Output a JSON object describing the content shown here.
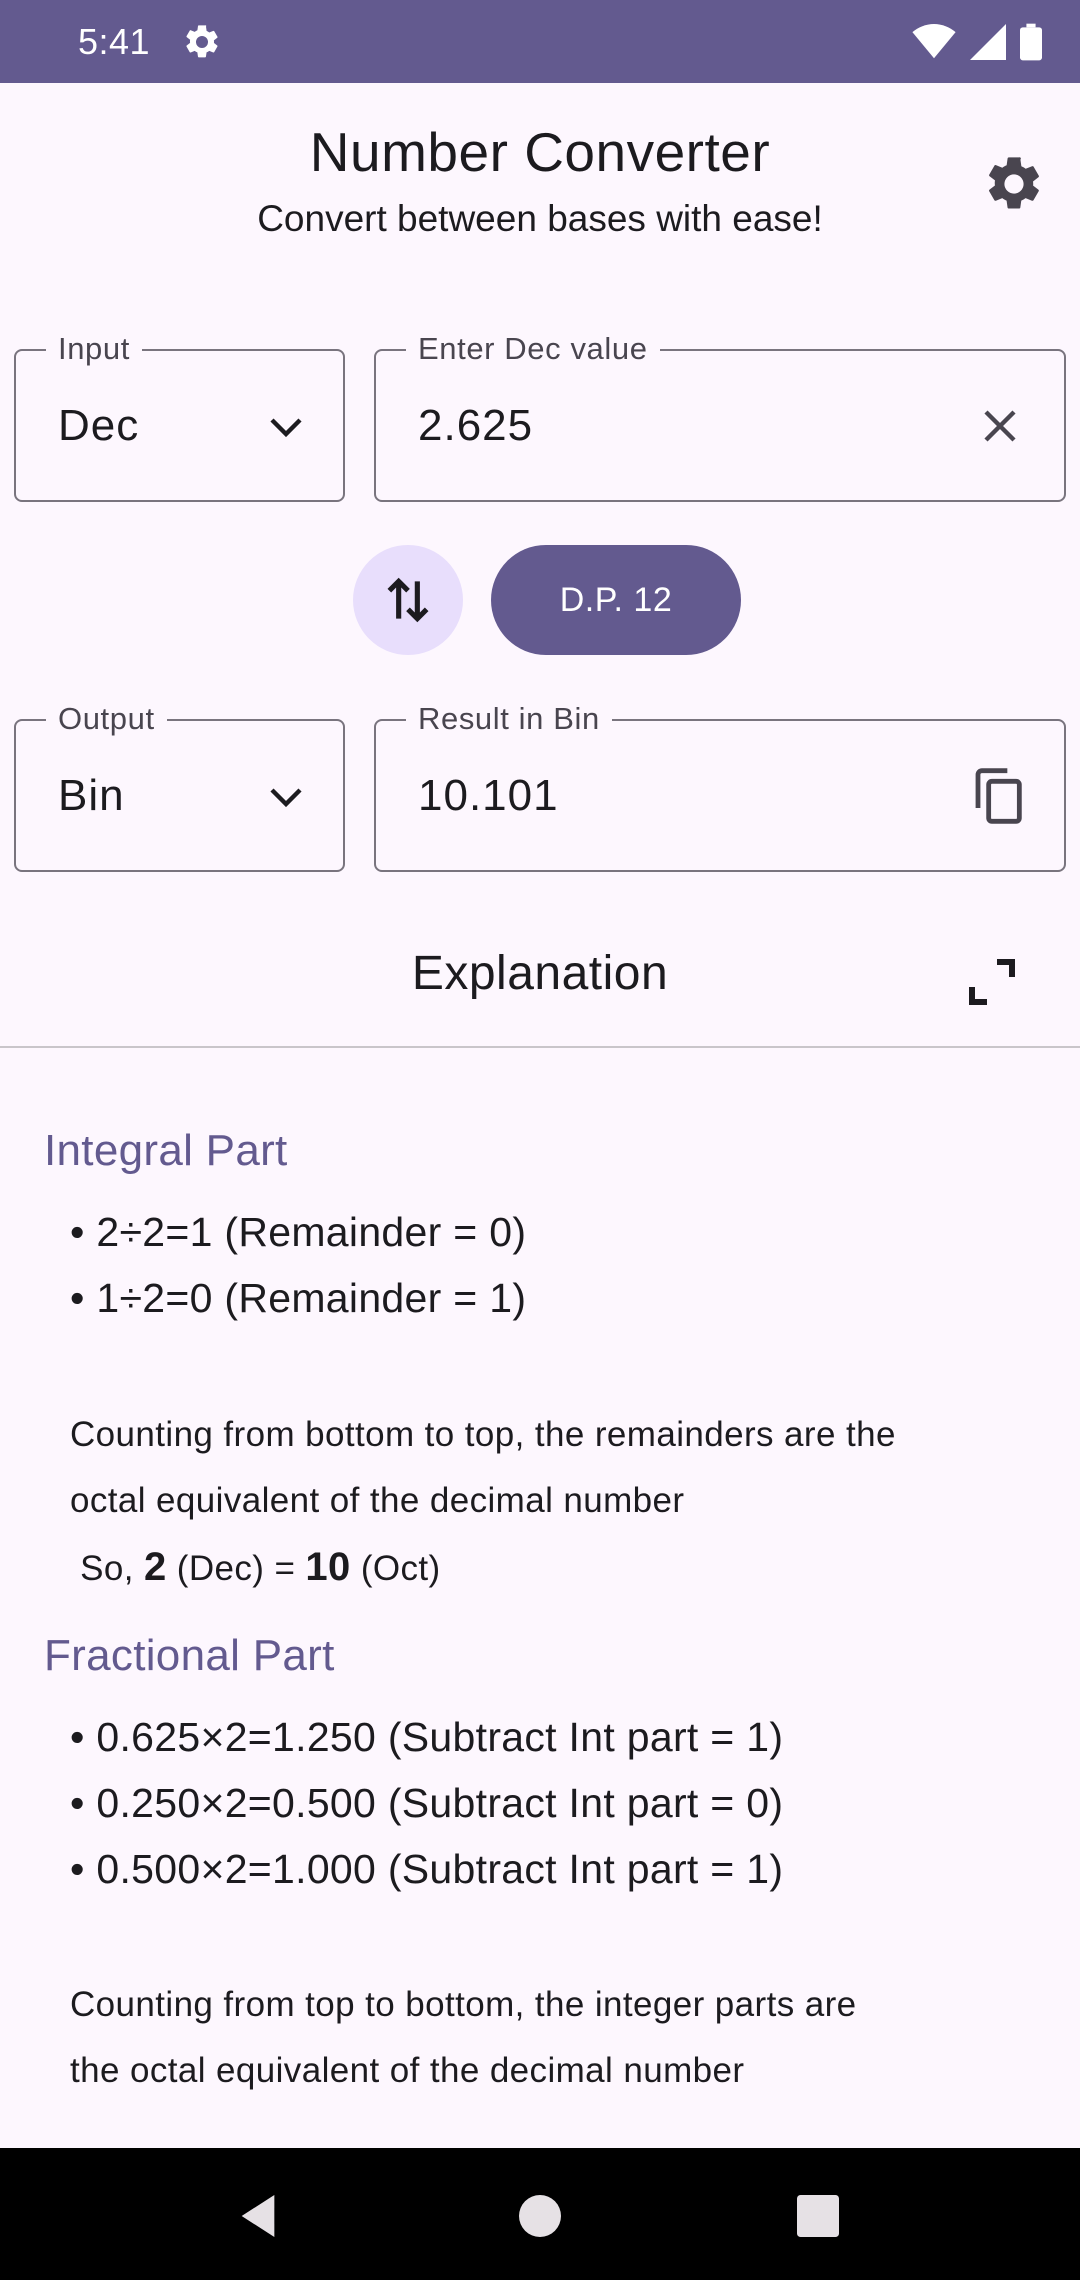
{
  "status_bar": {
    "time": "5:41",
    "icons": [
      "settings-icon",
      "wifi-icon",
      "signal-icon",
      "battery-icon"
    ],
    "color": "#635a8f"
  },
  "header": {
    "title": "Number Converter",
    "subtitle": "Convert between bases with ease!",
    "settings_icon": "gear-icon"
  },
  "input": {
    "base_label": "Input",
    "base_value": "Dec",
    "value_label": "Enter Dec value",
    "value": "2.625",
    "clear_icon": "close-icon"
  },
  "controls": {
    "swap_icon": "swap-vertical-icon",
    "dp_label": "D.P. 12"
  },
  "output": {
    "base_label": "Output",
    "base_value": "Bin",
    "result_label": "Result in Bin",
    "result": "10.101",
    "copy_icon": "copy-icon"
  },
  "explanation": {
    "title": "Explanation",
    "expand_icon": "fullscreen-icon",
    "integral": {
      "heading": "Integral Part",
      "steps": [
        {
          "text": "• 2÷2=1 (Remainder = ",
          "digit": "0",
          "close": ")"
        },
        {
          "text": "• 1÷2=0 (Remainder = ",
          "digit": "1",
          "close": ")"
        }
      ],
      "para_line1": "Counting from bottom to top, the remainders are the",
      "para_line2": "octal equivalent of the decimal number",
      "so_prefix": "So, ",
      "so_value": "2",
      "so_from": " (Dec) = ",
      "so_result": "10",
      "so_to": " (Oct)"
    },
    "fractional": {
      "heading": "Fractional Part",
      "steps": [
        {
          "text": "• 0.625×2=1.250 (Subtract Int part = ",
          "digit": "1",
          "close": ")"
        },
        {
          "text": "• 0.250×2=0.500 (Subtract Int part = ",
          "digit": "0",
          "close": ")"
        },
        {
          "text": "• 0.500×2=1.000 (Subtract Int part = ",
          "digit": "1",
          "close": ")"
        }
      ],
      "para_line1": "Counting from top to bottom, the integer parts are",
      "para_line2": "the octal equivalent of the decimal number"
    }
  },
  "colors": {
    "accent": "#635a8f",
    "accent_light": "#e8defc",
    "background": "#fdf7fe",
    "outline": "#79747e"
  }
}
